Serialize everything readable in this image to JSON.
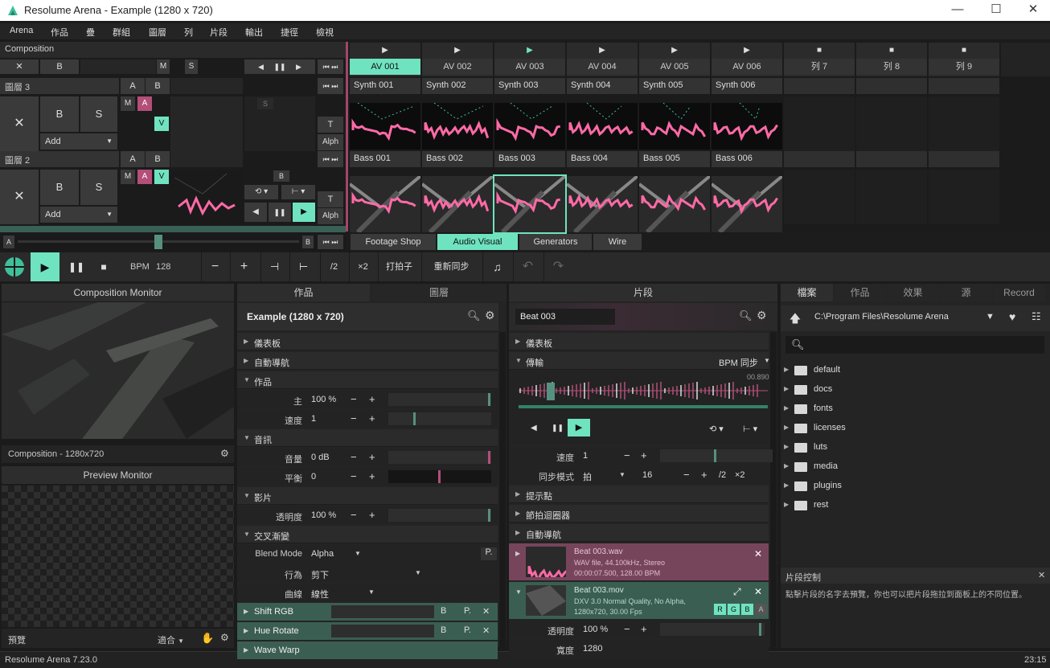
{
  "window": {
    "title": "Resolume Arena - Example (1280 x 720)",
    "min": "—",
    "max": "☐",
    "close": "✕"
  },
  "menu": [
    "Arena",
    "作品",
    "疊",
    "群組",
    "圖層",
    "列",
    "片段",
    "輸出",
    "捷徑",
    "檢視"
  ],
  "composition": {
    "label": "Composition",
    "x": "✕",
    "b": "B",
    "m": "M",
    "s": "S",
    "columns": [
      {
        "play": "▶",
        "name": "AV 001",
        "active": true
      },
      {
        "play": "▶",
        "name": "AV 002"
      },
      {
        "play": "▶",
        "name": "AV 003",
        "playing": true
      },
      {
        "play": "▶",
        "name": "AV 004"
      },
      {
        "play": "▶",
        "name": "AV 005"
      },
      {
        "play": "▶",
        "name": "AV 006"
      },
      {
        "play": "■",
        "name": "列 7"
      },
      {
        "play": "■",
        "name": "列 8"
      },
      {
        "play": "■",
        "name": "列 9"
      }
    ],
    "layers": [
      {
        "name": "圖層 3",
        "a": "A",
        "b": "B",
        "x": "✕",
        "B": "B",
        "S": "S",
        "add": "Add",
        "M": "M",
        "A2": "A",
        "V": "V",
        "T": "T",
        "alph": "Alph",
        "S2": "S",
        "clips": [
          "Synth 001",
          "Synth 002",
          "Synth 003",
          "Synth 004",
          "Synth 005",
          "Synth 006"
        ]
      },
      {
        "name": "圖層 2",
        "a": "A",
        "b": "B",
        "x": "✕",
        "B": "B",
        "S": "S",
        "add": "Add",
        "M": "M",
        "A2": "A",
        "V": "V",
        "T": "T",
        "alph": "Alph",
        "B2": "B",
        "clips": [
          "Bass 001",
          "Bass 002",
          "Bass 003",
          "Bass 004",
          "Bass 005",
          "Bass 006"
        ]
      }
    ],
    "crossfader": {
      "a": "A",
      "b": "B"
    },
    "decks": [
      "Footage Shop",
      "Audio Visual",
      "Generators",
      "Wire"
    ],
    "active_deck": "Audio Visual"
  },
  "transport": {
    "bpm_label": "BPM",
    "bpm": "128",
    "minus": "−",
    "plus": "+",
    "div": "/2",
    "mul": "×2",
    "tap": "打拍子",
    "resync": "重新同步"
  },
  "comp_monitor": {
    "title": "Composition Monitor",
    "caption": "Composition - 1280x720"
  },
  "preview_monitor": {
    "title": "Preview Monitor",
    "footer_left": "預覽",
    "footer_right": "適合"
  },
  "comp_panel": {
    "tabs": [
      "作品",
      "圖層"
    ],
    "title": "Example (1280 x 720)",
    "sections": {
      "dashboard": "儀表板",
      "autopilot": "自動導航",
      "comp": "作品",
      "audio": "音訊",
      "video": "影片",
      "crossfade": "交叉漸變"
    },
    "rows": {
      "master": {
        "label": "主",
        "value": "100 %",
        "level": 1.0
      },
      "speed": {
        "label": "速度",
        "value": "1",
        "level": 0.25
      },
      "volume": {
        "label": "音量",
        "value": "0 dB",
        "level": 1.0
      },
      "pan": {
        "label": "平衡",
        "value": "0",
        "level": 0.5
      },
      "opacity": {
        "label": "透明度",
        "value": "100 %",
        "level": 1.0
      },
      "blend": {
        "label": "Blend Mode",
        "value": "Alpha",
        "p": "P."
      },
      "behaviour": {
        "label": "行為",
        "value": "剪下"
      },
      "curve": {
        "label": "曲線",
        "value": "線性"
      }
    },
    "effects": [
      {
        "name": "Shift RGB",
        "b": "B",
        "p": "P.",
        "x": "✕"
      },
      {
        "name": "Hue Rotate",
        "b": "B",
        "p": "P.",
        "x": "✕"
      },
      {
        "name": "Wave Warp"
      }
    ]
  },
  "clip_panel": {
    "title": "片段",
    "clip_name": "Beat 003",
    "sections": {
      "dashboard": "儀表板",
      "transport": "傳輸",
      "cue": "提示點",
      "beat": "節拍迴圈器",
      "autopilot": "自動導航"
    },
    "transport_mode": "BPM 同步",
    "time": "00.890",
    "speed": {
      "label": "速度",
      "value": "1"
    },
    "sync": {
      "label": "同步模式",
      "value": "拍",
      "beats": "16",
      "div": "/2",
      "mul": "×2"
    },
    "audio_file": {
      "name": "Beat 003.wav",
      "line1": "WAV file, 44.100kHz, Stereo",
      "line2": "00:00:07.500, 128.00 BPM",
      "x": "✕"
    },
    "video_file": {
      "name": "Beat 003.mov",
      "line1": "DXV 3.0 Normal Quality, No Alpha,",
      "line2": "1280x720, 30.00 Fps",
      "r": "R",
      "g": "G",
      "b": "B",
      "a": "A",
      "x": "✕"
    },
    "opacity": {
      "label": "透明度",
      "value": "100 %"
    },
    "width": {
      "label": "寬度",
      "value": "1280"
    }
  },
  "browser": {
    "tabs": [
      "檔案",
      "作品",
      "效果",
      "源",
      "Record"
    ],
    "path": "C:\\Program Files\\Resolume Arena",
    "folders": [
      "default",
      "docs",
      "fonts",
      "licenses",
      "luts",
      "media",
      "plugins",
      "rest"
    ]
  },
  "clip_help": {
    "title": "片段控制",
    "text": "點擊片段的名字去預覽，你也可以把片段拖拉到面板上的不同位置。",
    "x": "✕"
  },
  "status": {
    "left": "Resolume Arena 7.23.0",
    "right": "23:15"
  }
}
